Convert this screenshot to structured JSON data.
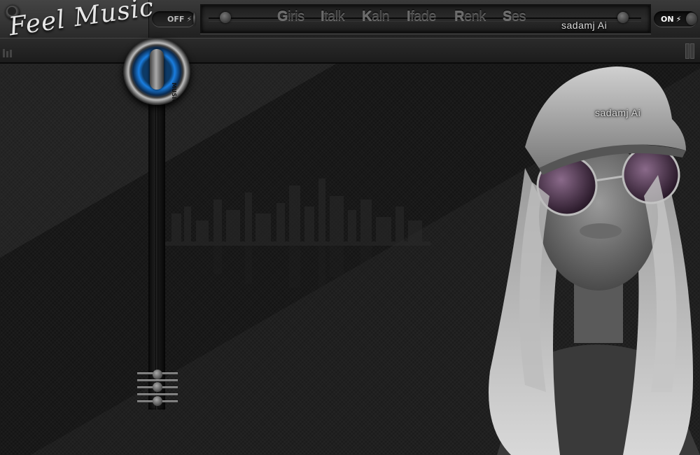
{
  "app": {
    "logo_text": "Feel Music",
    "signature_top": "sadamj Ai",
    "signature_portrait": "sadamj Ai"
  },
  "toggles": {
    "off_label": "OFF",
    "on_label": "ON"
  },
  "menu": {
    "items": [
      {
        "initial": "G",
        "rest": "iris"
      },
      {
        "initial": "I",
        "rest": "talk"
      },
      {
        "initial": "K",
        "rest": "aln"
      },
      {
        "initial": "I",
        "rest": "fade"
      },
      {
        "initial": "R",
        "rest": "enk"
      },
      {
        "initial": "S",
        "rest": "es"
      }
    ]
  },
  "volume": {
    "knob_label": "MUSIC"
  },
  "colors": {
    "accent_blue": "#1a7ee0",
    "background": "#141414",
    "topbar": "#2a2a2a"
  }
}
